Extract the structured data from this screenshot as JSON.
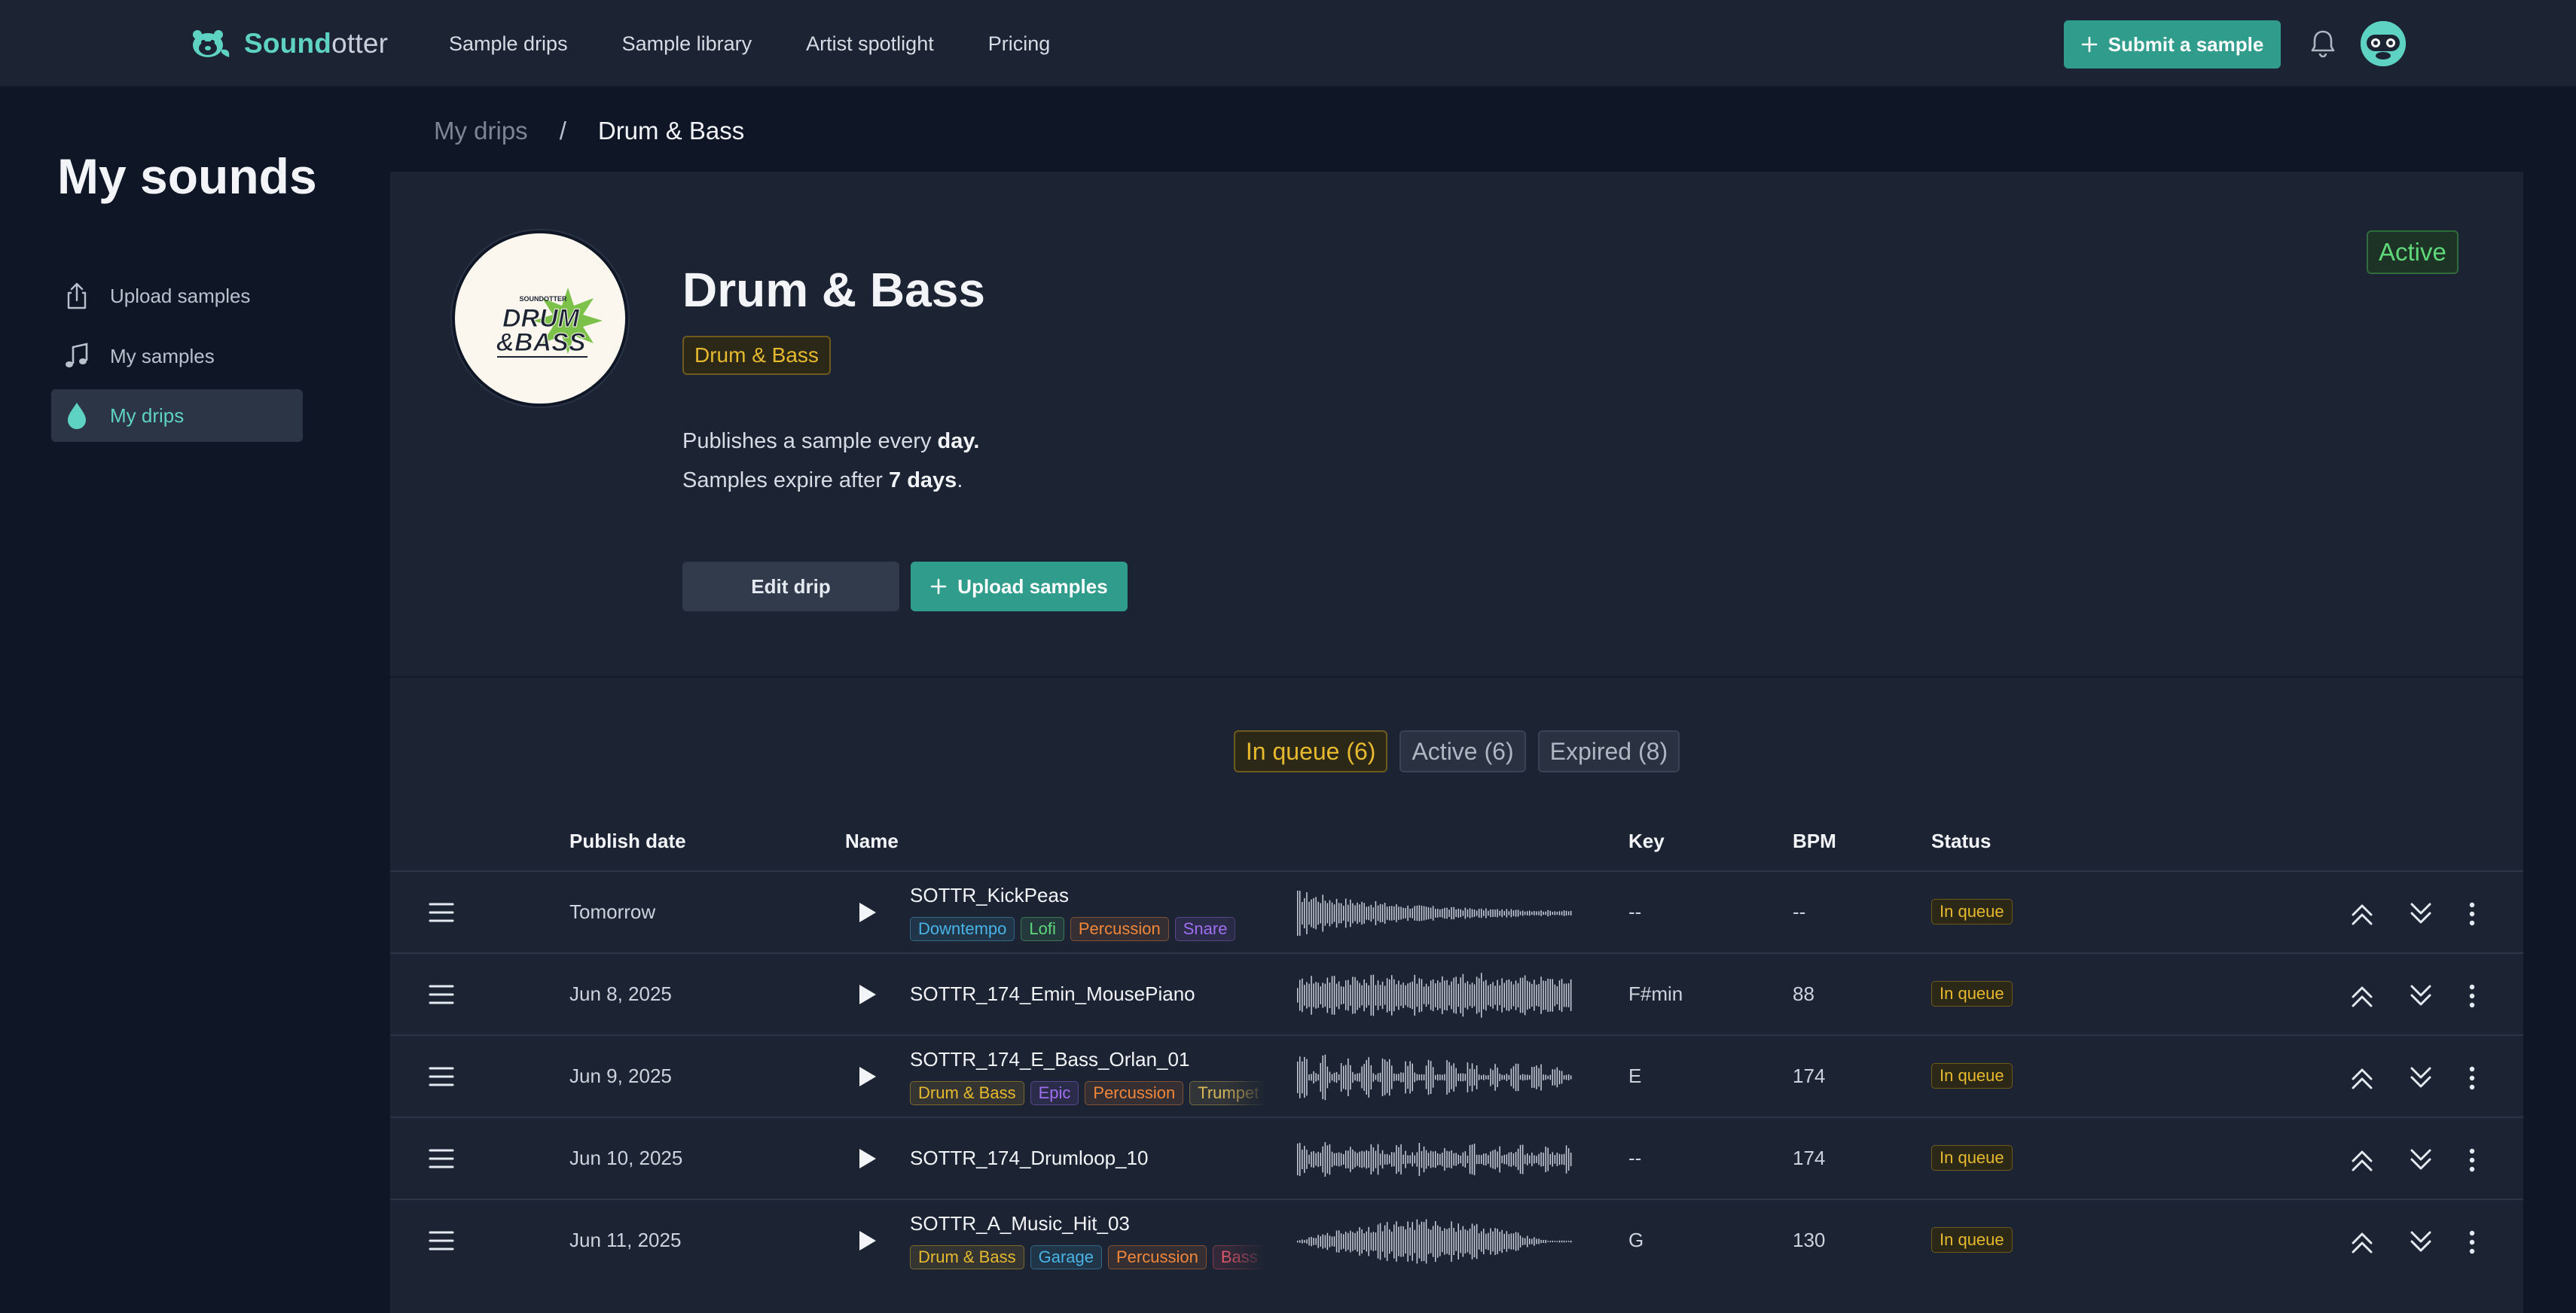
{
  "app": {
    "brand_part1": "Sound",
    "brand_part2": "otter"
  },
  "nav": {
    "links": [
      "Sample drips",
      "Sample library",
      "Artist spotlight",
      "Pricing"
    ],
    "submit_label": "Submit a sample"
  },
  "sidebar": {
    "title": "My sounds",
    "items": [
      {
        "label": "Upload samples",
        "icon": "upload-icon"
      },
      {
        "label": "My samples",
        "icon": "music-note-icon"
      },
      {
        "label": "My drips",
        "icon": "droplet-icon",
        "active": true
      }
    ]
  },
  "breadcrumb": {
    "parent": "My drips",
    "separator": "/",
    "current": "Drum & Bass"
  },
  "drip": {
    "title": "Drum & Bass",
    "genre": "Drum & Bass",
    "status": "Active",
    "publish_prefix": "Publishes a sample every ",
    "publish_value": "day.",
    "expire_prefix": "Samples expire after ",
    "expire_value": "7 days",
    "expire_suffix": ".",
    "edit_label": "Edit drip",
    "upload_label": "Upload samples",
    "logo_small_text": "SOUNDOTTER",
    "logo_line1": "DRUM",
    "logo_line2": "&BASS"
  },
  "tabs": [
    {
      "label": "In queue (6)",
      "selected": true
    },
    {
      "label": "Active (6)"
    },
    {
      "label": "Expired (8)"
    }
  ],
  "table": {
    "headers": {
      "publish_date": "Publish date",
      "name": "Name",
      "key": "Key",
      "bpm": "BPM",
      "status": "Status"
    },
    "rows": [
      {
        "date": "Tomorrow",
        "name": "SOTTR_KickPeas",
        "tags": [
          "Downtempo",
          "Lofi",
          "Percussion",
          "Snare"
        ],
        "key": "--",
        "bpm": "--",
        "status": "In queue"
      },
      {
        "date": "Jun 8, 2025",
        "name": "SOTTR_174_Emin_MousePiano",
        "tags": [],
        "key": "F#min",
        "bpm": "88",
        "status": "In queue"
      },
      {
        "date": "Jun 9, 2025",
        "name": "SOTTR_174_E_Bass_Orlan_01",
        "tags": [
          "Drum & Bass",
          "Epic",
          "Percussion",
          "Trumpet"
        ],
        "key": "E",
        "bpm": "174",
        "status": "In queue"
      },
      {
        "date": "Jun 10, 2025",
        "name": "SOTTR_174_Drumloop_10",
        "tags": [],
        "key": "--",
        "bpm": "174",
        "status": "In queue"
      },
      {
        "date": "Jun 11, 2025",
        "name": "SOTTR_A_Music_Hit_03",
        "tags": [
          "Drum & Bass",
          "Garage",
          "Percussion",
          "Bass"
        ],
        "key": "G",
        "bpm": "130",
        "status": "In queue"
      }
    ]
  },
  "colors": {
    "accent": "#2f9c8c",
    "accent_text": "#5ed3c3",
    "queue_yellow": "#e6b92e",
    "active_green": "#5fd87a",
    "tag_colors": {
      "Downtempo": "#4ab3e6",
      "Lofi": "#5fd87a",
      "Percussion": "#f0873a",
      "Snare": "#a06ef0",
      "Drum & Bass": "#e6b92e",
      "Epic": "#a06ef0",
      "Trumpet": "#d6b85a",
      "Garage": "#4ab3e6",
      "Bass": "#e0566a"
    }
  }
}
